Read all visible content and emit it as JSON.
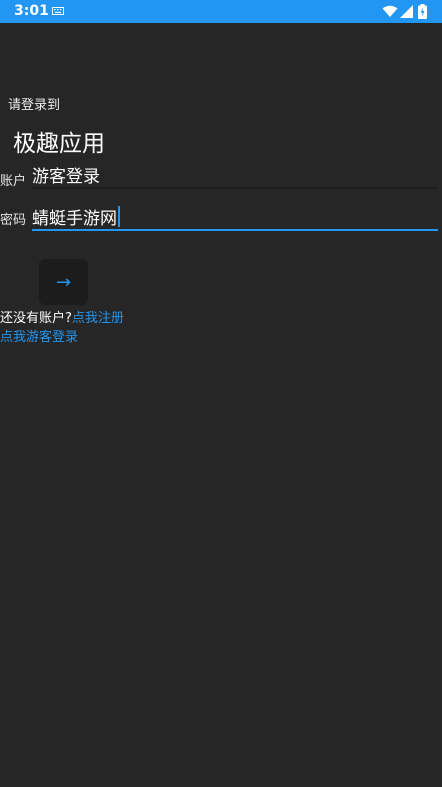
{
  "status_bar": {
    "time": "3:01",
    "color": "#2196f3",
    "icons": [
      "keyboard-icon",
      "wifi-icon",
      "signal-icon",
      "battery-icon"
    ]
  },
  "login": {
    "prompt": "请登录到",
    "app_name": "极趣应用",
    "account_label": "账户",
    "account_value": "游客登录",
    "password_label": "密码",
    "password_value": "蜻蜓手游网",
    "submit_icon": "→",
    "no_account_text": "还没有账户?",
    "register_link": "点我注册",
    "guest_link": "点我游客登录"
  },
  "colors": {
    "background": "#262626",
    "accent": "#2196f3"
  }
}
